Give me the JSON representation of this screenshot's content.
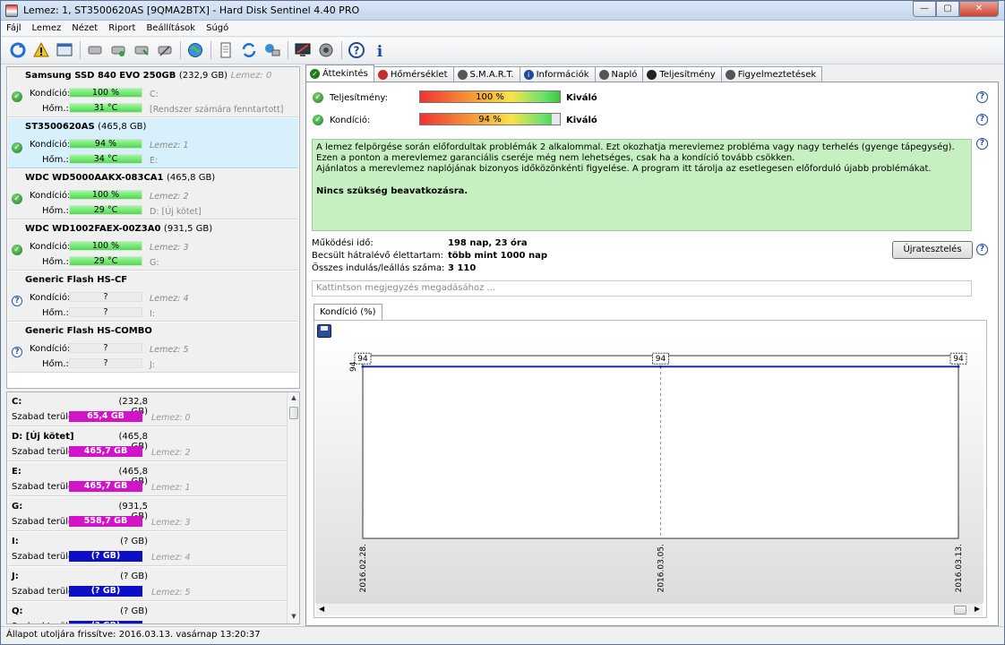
{
  "window": {
    "title": "Lemez: 1, ST3500620AS [9QMA2BTX]  -  Hard Disk Sentinel 4.40 PRO",
    "min": "—",
    "max": "▢",
    "close": "✕"
  },
  "menu": [
    "Fájl",
    "Lemez",
    "Nézet",
    "Riport",
    "Beállítások",
    "Súgó"
  ],
  "disks": [
    {
      "name": "Samsung SSD 840 EVO 250GB",
      "size": "(232,9 GB)",
      "disk_label": "Lemez: 0",
      "cond_label": "Kondíció:",
      "cond_value": "100 %",
      "cond_info": "C:",
      "temp_label": "Hőm.:",
      "temp_value": "31 °C",
      "temp_info": "[Rendszer számára fenntartott]",
      "status": "ok"
    },
    {
      "name": "ST3500620AS",
      "size": "(465,8 GB)",
      "disk_label": "",
      "cond_label": "Kondíció:",
      "cond_value": "94 %",
      "cond_info": "Lemez: 1",
      "temp_label": "Hőm.:",
      "temp_value": "34 °C",
      "temp_info": "E:",
      "status": "ok"
    },
    {
      "name": "WDC WD5000AAKX-083CA1",
      "size": "(465,8 GB)",
      "disk_label": "",
      "cond_label": "Kondíció:",
      "cond_value": "100 %",
      "cond_info": "Lemez: 2",
      "temp_label": "Hőm.:",
      "temp_value": "29 °C",
      "temp_info": "D: [Új kötet]",
      "status": "ok"
    },
    {
      "name": "WDC WD1002FAEX-00Z3A0",
      "size": "(931,5 GB)",
      "disk_label": "",
      "cond_label": "Kondíció:",
      "cond_value": "100 %",
      "cond_info": "Lemez: 3",
      "temp_label": "Hőm.:",
      "temp_value": "29 °C",
      "temp_info": "G:",
      "status": "ok"
    },
    {
      "name": "Generic Flash HS-CF",
      "size": "",
      "disk_label": "",
      "cond_label": "Kondíció:",
      "cond_value": "?",
      "cond_info": "Lemez: 4",
      "temp_label": "Hőm.:",
      "temp_value": "?",
      "temp_info": "I:",
      "status": "unknown"
    },
    {
      "name": "Generic Flash HS-COMBO",
      "size": "",
      "disk_label": "",
      "cond_label": "Kondíció:",
      "cond_value": "?",
      "cond_info": "Lemez: 5",
      "temp_label": "Hőm.:",
      "temp_value": "?",
      "temp_info": "J:",
      "status": "unknown"
    }
  ],
  "partitions": [
    {
      "name": "C:",
      "size": "(232,8 GB)",
      "label": "Szabad terület",
      "free": "65,4 GB",
      "disk": "Lemez: 0",
      "color": "#d214c8"
    },
    {
      "name": "D: [Új kötet]",
      "size": "(465,8 GB)",
      "label": "Szabad terület",
      "free": "465,7 GB",
      "disk": "Lemez: 2",
      "color": "#d214c8"
    },
    {
      "name": "E:",
      "size": "(465,8 GB)",
      "label": "Szabad terület",
      "free": "465,7 GB",
      "disk": "Lemez: 1",
      "color": "#d214c8"
    },
    {
      "name": "G:",
      "size": "(931,5 GB)",
      "label": "Szabad terület",
      "free": "558,7 GB",
      "disk": "Lemez: 3",
      "color": "#d214c8"
    },
    {
      "name": "I:",
      "size": "(? GB)",
      "label": "Szabad terület",
      "free": "(? GB)",
      "disk": "Lemez: 4",
      "color": "#0b0fc8"
    },
    {
      "name": "J:",
      "size": "(? GB)",
      "label": "Szabad terület",
      "free": "(? GB)",
      "disk": "Lemez: 5",
      "color": "#0b0fc8"
    },
    {
      "name": "Q:",
      "size": "(? GB)",
      "label": "Szabad terület",
      "free": "(? GB)",
      "disk": "",
      "color": "#0b0fc8"
    }
  ],
  "tabs": [
    {
      "label": "Áttekintés",
      "icon": "check-icon",
      "color": "#1c7d1c"
    },
    {
      "label": "Hőmérséklet",
      "icon": "thermometer-icon",
      "color": "#c03030"
    },
    {
      "label": "S.M.A.R.T.",
      "icon": "smart-icon",
      "color": "#555"
    },
    {
      "label": "Információk",
      "icon": "info-icon",
      "color": "#1f4a9a"
    },
    {
      "label": "Napló",
      "icon": "log-icon",
      "color": "#555"
    },
    {
      "label": "Teljesítmény",
      "icon": "gauge-icon",
      "color": "#222"
    },
    {
      "label": "Figyelmeztetések",
      "icon": "alert-icon",
      "color": "#555"
    }
  ],
  "overview": {
    "performance_label": "Teljesítmény:",
    "performance_value": "100 %",
    "performance_pct": 100,
    "performance_rating": "Kiváló",
    "condition_label": "Kondíció:",
    "condition_value": "94 %",
    "condition_pct": 94,
    "condition_rating": "Kiváló",
    "message_lines": [
      "A lemez felpörgése során előfordultak problémák 2 alkalommal. Ezt okozhatja merevlemez probléma vagy nagy terhelés (gyenge tápegység).",
      "Ezen a ponton a merevlemez garanciális cseréje még nem lehetséges, csak ha a kondíció tovább csökken.",
      "Ajánlatos a merevlemez naplójának bizonyos időközönkénti figyelése. A program itt tárolja az esetlegesen előforduló újabb problémákat."
    ],
    "message_strong": "Nincs szükség beavatkozásra.",
    "uptime_label": "Működési idő:",
    "uptime_value": "198 nap, 23 óra",
    "lifetime_label": "Becsült hátralévő élettartam:",
    "lifetime_value": "több mint 1000 nap",
    "startstop_label": "Összes indulás/leállás száma:",
    "startstop_value": "3 110",
    "retest_button": "Újratesztelés",
    "note_placeholder": "Kattintson megjegyzés megadásához ..."
  },
  "chart_tab": "Kondíció  (%)",
  "chart_data": {
    "type": "line",
    "x": [
      "2016.02.28.",
      "2016.03.05.",
      "2016.03.13."
    ],
    "values": [
      94,
      94,
      94
    ],
    "data_labels": [
      "94",
      "94",
      "94"
    ],
    "y_axis_label": "94",
    "ylim": [
      0,
      100
    ],
    "grid": true,
    "line_color": "#1a2fa8"
  },
  "status": "Állapot utoljára frissítve: 2016.03.13. vasárnap 13:20:37"
}
